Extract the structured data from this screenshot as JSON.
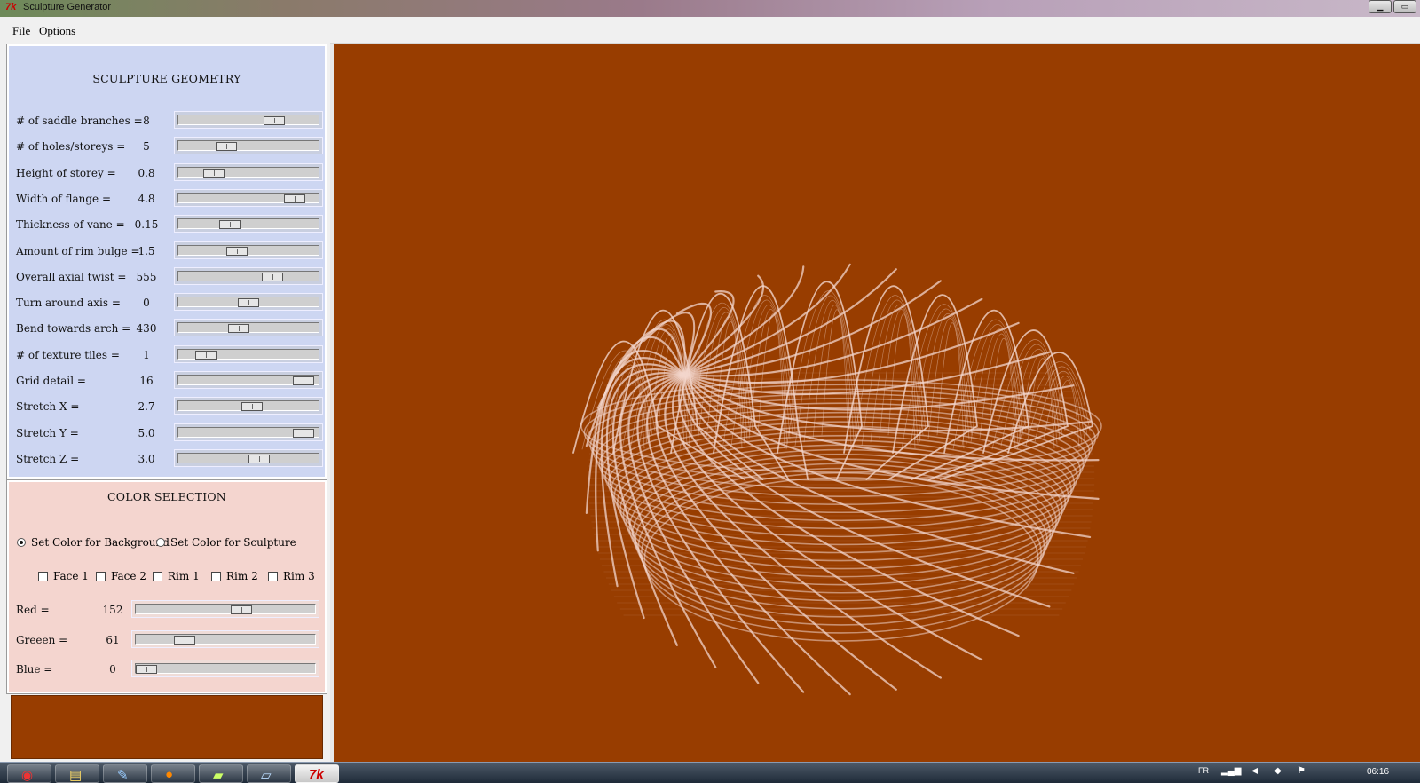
{
  "window": {
    "title": "Sculpture Generator",
    "logo": "7k",
    "minimize": "▁",
    "maximize": "▭"
  },
  "menu": [
    "File",
    "Options"
  ],
  "geometry": {
    "heading": "SCULPTURE GEOMETRY",
    "rows": [
      {
        "label": "# of saddle branches =",
        "value": "8",
        "pos": 0.72
      },
      {
        "label": "# of holes/storeys =",
        "value": "5",
        "pos": 0.31
      },
      {
        "label": "Height of storey =",
        "value": "0.8",
        "pos": 0.21
      },
      {
        "label": "Width of flange =",
        "value": "4.8",
        "pos": 0.89
      },
      {
        "label": "Thickness of vane =",
        "value": "0.15",
        "pos": 0.34
      },
      {
        "label": "Amount of rim bulge =",
        "value": "1.5",
        "pos": 0.4
      },
      {
        "label": "Overall axial twist =",
        "value": "555",
        "pos": 0.7
      },
      {
        "label": "Turn around axis =",
        "value": "0",
        "pos": 0.5
      },
      {
        "label": "Bend towards arch =",
        "value": "430",
        "pos": 0.42
      },
      {
        "label": "# of texture tiles =",
        "value": "1",
        "pos": 0.14
      },
      {
        "label": "Grid detail =",
        "value": "16",
        "pos": 0.96
      },
      {
        "label": "Stretch X =",
        "value": "2.7",
        "pos": 0.53
      },
      {
        "label": "Stretch Y =",
        "value": "5.0",
        "pos": 0.96
      },
      {
        "label": "Stretch Z =",
        "value": "3.0",
        "pos": 0.59
      }
    ]
  },
  "colorSelection": {
    "heading": "COLOR SELECTION",
    "radios": [
      {
        "label": "Set Color for Background",
        "checked": true
      },
      {
        "label": "Set Color for Sculpture",
        "checked": false
      }
    ],
    "checks": [
      "Face 1",
      "Face 2",
      "Rim 1",
      "Rim 2",
      "Rim 3"
    ],
    "rows": [
      {
        "label": "Red =",
        "value": "152",
        "pos": 0.6
      },
      {
        "label": "Greeen =",
        "value": "61",
        "pos": 0.24
      },
      {
        "label": "Blue =",
        "value": "0",
        "pos": 0.0
      }
    ]
  },
  "colors": {
    "background": "#983d00",
    "sculpture": "#f3d6cc"
  },
  "taskbar": {
    "apps": [
      "chrome-icon",
      "file-explorer-icon",
      "paint-icon",
      "firefox-icon",
      "folder-icon",
      "notepad-icon",
      "tk-app-icon"
    ],
    "language": "FR",
    "clock": "06:16"
  }
}
